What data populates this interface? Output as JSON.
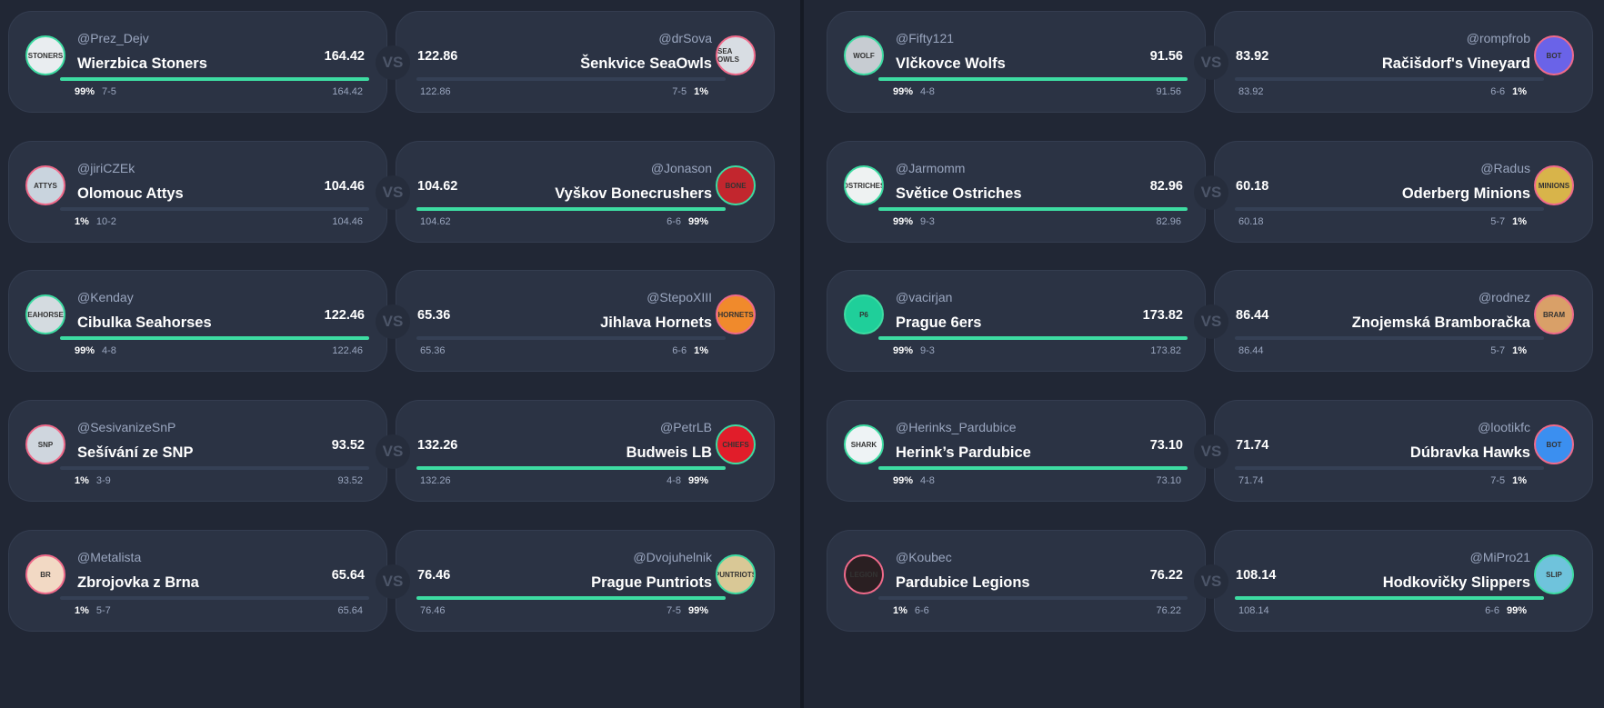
{
  "vs_label": "VS",
  "colors": {
    "background": "#212735",
    "card": "#2b3344",
    "win_green": "#3ddca2",
    "lose_pink": "#f06a8a"
  },
  "matchups": [
    {
      "home": {
        "handle": "@Prez_Dejv",
        "team": "Wierzbica Stoners",
        "score": "164.42",
        "win_pct": "99%",
        "record": "7-5",
        "winner": true,
        "avatar_text": "STONERS",
        "avatar_bg": "#e9edf0"
      },
      "away": {
        "handle": "@drSova",
        "team": "Šenkvice SeaOwls",
        "score": "122.86",
        "win_pct": "1%",
        "record": "7-5",
        "winner": false,
        "avatar_text": "SEA OWLS",
        "avatar_bg": "#d8dde3"
      }
    },
    {
      "home": {
        "handle": "@jiriCZEk",
        "team": "Olomouc Attys",
        "score": "104.46",
        "win_pct": "1%",
        "record": "10-2",
        "winner": false,
        "avatar_text": "ATTYS",
        "avatar_bg": "#c9d4de"
      },
      "away": {
        "handle": "@Jonason",
        "team": "Vyškov Bonecrushers",
        "score": "104.62",
        "win_pct": "99%",
        "record": "6-6",
        "winner": true,
        "avatar_text": "BONE",
        "avatar_bg": "#c2262e"
      }
    },
    {
      "home": {
        "handle": "@Kenday",
        "team": "Cibulka Seahorses",
        "score": "122.46",
        "win_pct": "99%",
        "record": "4-8",
        "winner": true,
        "avatar_text": "SEAHORSES",
        "avatar_bg": "#d4dbe0"
      },
      "away": {
        "handle": "@StepoXIII",
        "team": "Jihlava Hornets",
        "score": "65.36",
        "win_pct": "1%",
        "record": "6-6",
        "winner": false,
        "avatar_text": "HORNETS",
        "avatar_bg": "#f08a2c"
      }
    },
    {
      "home": {
        "handle": "@SesivanizeSnP",
        "team": "Sešívání ze SNP",
        "score": "93.52",
        "win_pct": "1%",
        "record": "3-9",
        "winner": false,
        "avatar_text": "SNP",
        "avatar_bg": "#cfd6de"
      },
      "away": {
        "handle": "@PetrLB",
        "team": "Budweis LB",
        "score": "132.26",
        "win_pct": "99%",
        "record": "4-8",
        "winner": true,
        "avatar_text": "CHIEFS",
        "avatar_bg": "#e11d2a"
      }
    },
    {
      "home": {
        "handle": "@Metalista",
        "team": "Zbrojovka z Brna",
        "score": "65.64",
        "win_pct": "1%",
        "record": "5-7",
        "winner": false,
        "avatar_text": "BR",
        "avatar_bg": "#f2d9c4"
      },
      "away": {
        "handle": "@Dvojuhelnik",
        "team": "Prague Puntriots",
        "score": "76.46",
        "win_pct": "99%",
        "record": "7-5",
        "winner": true,
        "avatar_text": "PUNTRIOTS",
        "avatar_bg": "#d9c896"
      }
    },
    {
      "home": {
        "handle": "@Fifty121",
        "team": "Vlčkovce Wolfs",
        "score": "91.56",
        "win_pct": "99%",
        "record": "4-8",
        "winner": true,
        "avatar_text": "WOLF",
        "avatar_bg": "#c7ccd2"
      },
      "away": {
        "handle": "@rompfrob",
        "team": "Račišdorf's Vineyard",
        "score": "83.92",
        "win_pct": "1%",
        "record": "6-6",
        "winner": false,
        "avatar_text": "BOT",
        "avatar_bg": "#6a63e8"
      }
    },
    {
      "home": {
        "handle": "@Jarmomm",
        "team": "Světice Ostriches",
        "score": "82.96",
        "win_pct": "99%",
        "record": "9-3",
        "winner": true,
        "avatar_text": "OSTRICHES",
        "avatar_bg": "#eef2f2"
      },
      "away": {
        "handle": "@Radus",
        "team": "Oderberg Minions",
        "score": "60.18",
        "win_pct": "1%",
        "record": "5-7",
        "winner": false,
        "avatar_text": "MINIONS",
        "avatar_bg": "#d8b44a"
      }
    },
    {
      "home": {
        "handle": "@vacirjan",
        "team": "Prague 6ers",
        "score": "173.82",
        "win_pct": "99%",
        "record": "9-3",
        "winner": true,
        "avatar_text": "P6",
        "avatar_bg": "#1fcf9a"
      },
      "away": {
        "handle": "@rodnez",
        "team": "Znojemská Bramboračka",
        "score": "86.44",
        "win_pct": "1%",
        "record": "5-7",
        "winner": false,
        "avatar_text": "BRAM",
        "avatar_bg": "#d9a068"
      }
    },
    {
      "home": {
        "handle": "@Herinks_Pardubice",
        "team": "Herink’s Pardubice",
        "score": "73.10",
        "win_pct": "99%",
        "record": "4-8",
        "winner": true,
        "avatar_text": "SHARK",
        "avatar_bg": "#eef3f5"
      },
      "away": {
        "handle": "@lootikfc",
        "team": "Dúbravka Hawks",
        "score": "71.74",
        "win_pct": "1%",
        "record": "7-5",
        "winner": false,
        "avatar_text": "BOT",
        "avatar_bg": "#3b8ff0"
      }
    },
    {
      "home": {
        "handle": "@Koubec",
        "team": "Pardubice Legions",
        "score": "76.22",
        "win_pct": "1%",
        "record": "6-6",
        "winner": false,
        "avatar_text": "LEGION",
        "avatar_bg": "#2a1f22"
      },
      "away": {
        "handle": "@MiPro21",
        "team": "Hodkovičky Slippers",
        "score": "108.14",
        "win_pct": "99%",
        "record": "6-6",
        "winner": true,
        "avatar_text": "SLIP",
        "avatar_bg": "#6fc3dc"
      }
    }
  ]
}
